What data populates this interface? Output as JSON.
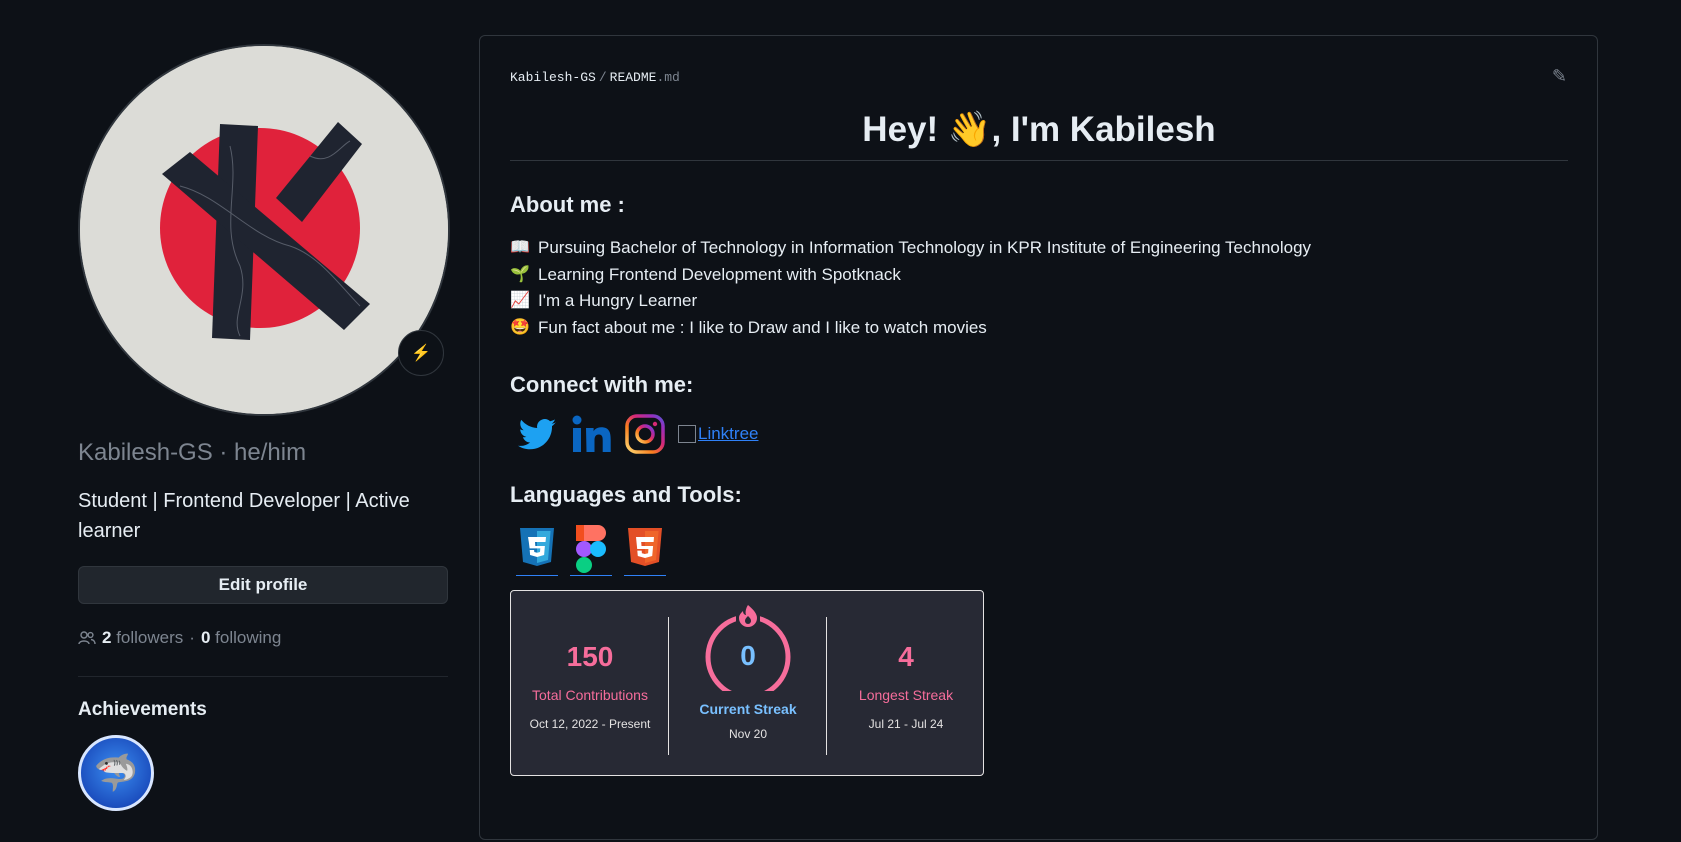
{
  "profile": {
    "username": "Kabilesh-GS · he/him",
    "bio": "Student | Frontend Developer | Active learner",
    "edit_label": "Edit profile",
    "followers_count": "2",
    "followers_label": "followers",
    "dot": "·",
    "following_count": "0",
    "following_label": "following",
    "achievements_title": "Achievements"
  },
  "readme": {
    "owner": "Kabilesh-GS",
    "separator": "/",
    "file": "README",
    "ext": ".md",
    "title": "Hey! 👋, I'm Kabilesh",
    "about_heading": "About me :",
    "about_items": [
      {
        "emoji": "📖",
        "text": "Pursuing Bachelor of Technology in Information Technology in KPR Institute of Engineering Technology"
      },
      {
        "emoji": "🌱",
        "text": "Learning Frontend Development with Spotknack"
      },
      {
        "emoji": "📈",
        "text": "I'm a Hungry Learner"
      },
      {
        "emoji": "🤩",
        "text": "Fun fact about me : I like to Draw and I like to watch movies"
      }
    ],
    "connect_heading": "Connect with me:",
    "linktree_label": "Linktree",
    "tools_heading": "Languages and Tools:"
  },
  "streak": {
    "total_value": "150",
    "total_label": "Total Contributions",
    "total_range": "Oct 12, 2022 - Present",
    "current_value": "0",
    "current_label": "Current Streak",
    "current_date": "Nov 20",
    "longest_value": "4",
    "longest_label": "Longest Streak",
    "longest_range": "Jul 21 - Jul 24"
  },
  "colors": {
    "background": "#0d1117",
    "streak_accent": "#f66d9b",
    "streak_current": "#79c0ff",
    "link": "#2f81f7"
  }
}
